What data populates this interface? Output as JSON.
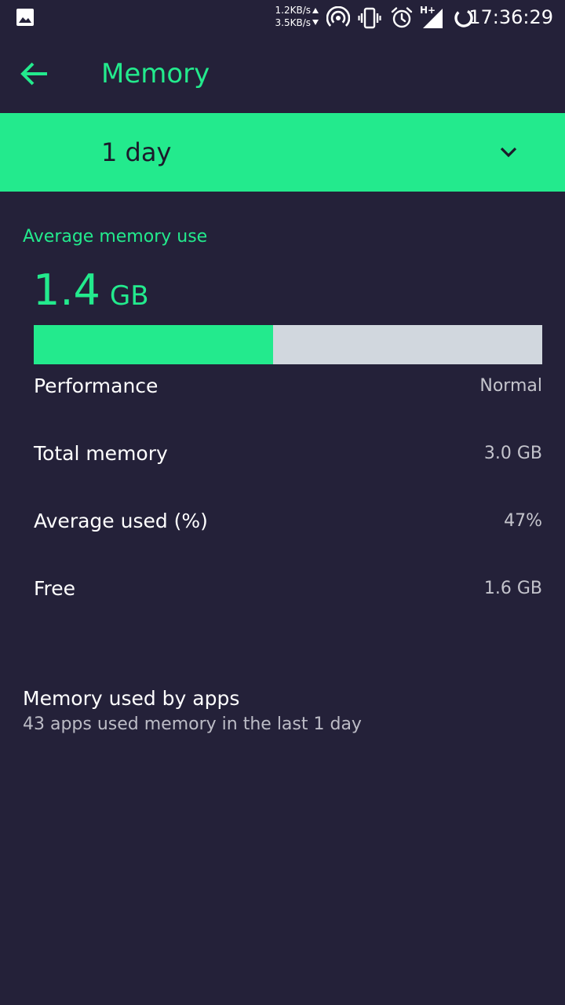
{
  "status_bar": {
    "upload_speed": "1.2KB/s",
    "download_speed": "3.5KB/s",
    "network_type": "H+",
    "time": "17:36:29",
    "icons": [
      "gallery-icon",
      "hotspot-icon",
      "vibrate-icon",
      "alarm-icon",
      "signal-icon",
      "loading-icon"
    ]
  },
  "app_bar": {
    "title": "Memory",
    "back_icon": "arrow-back-icon"
  },
  "period": {
    "selected": "1 day",
    "dropdown_icon": "chevron-down-icon"
  },
  "summary": {
    "title": "Average memory use",
    "value": "1.4",
    "unit": "GB",
    "usage_fraction": 0.47
  },
  "stats": [
    {
      "label": "Performance",
      "value": "Normal"
    },
    {
      "label": "Total memory",
      "value": "3.0 GB"
    },
    {
      "label": "Average used (%)",
      "value": "47%"
    },
    {
      "label": "Free",
      "value": "1.6 GB"
    }
  ],
  "apps": {
    "title": "Memory used by apps",
    "subtitle": "43 apps used memory in the last 1 day"
  },
  "colors": {
    "background": "#242139",
    "accent": "#23ea8d",
    "bar_track": "#d1d7de",
    "secondary_text": "#c4c4cc"
  }
}
